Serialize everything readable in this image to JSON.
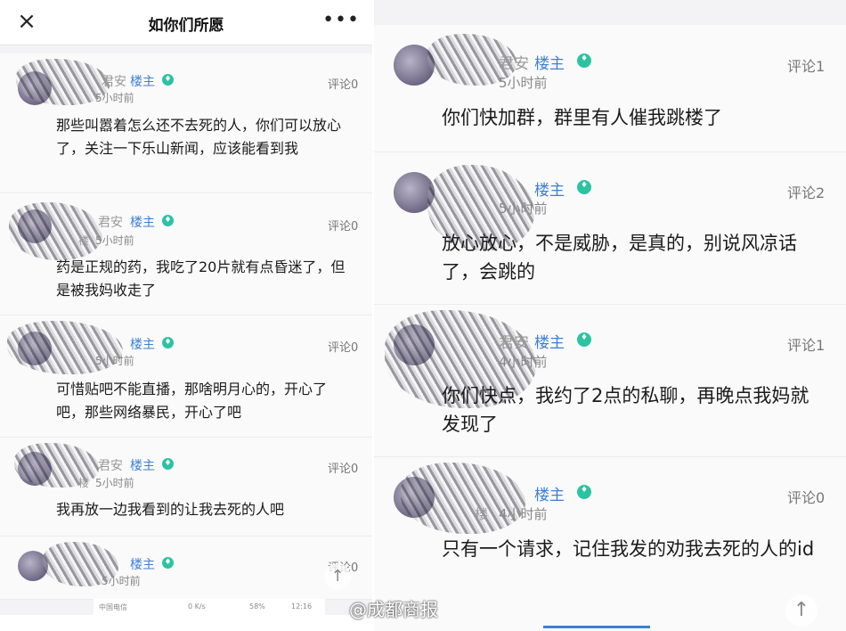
{
  "topbar": {
    "close_icon": "×",
    "title": "如你们所愿",
    "more_icon": "•••"
  },
  "louzhu_label": "楼主",
  "left_posts": [
    {
      "name": "君安",
      "time": "5小时前",
      "comment": "评论0",
      "body": "那些叫嚣着怎么还不去死的人，你们可以放心了，关注一下乐山新闻，应该能看到我"
    },
    {
      "name": "君安",
      "floor": "楼",
      "time": "5小时前",
      "comment": "评论0",
      "body": "药是正规的药，我吃了20片就有点昏迷了，但是被我妈收走了"
    },
    {
      "name": "",
      "time": "5小时前",
      "comment": "评论0",
      "body": "可惜贴吧不能直播，那啥明月心的，开心了吧，那些网络暴民，开心了吧"
    },
    {
      "name": "君安",
      "floor": "楼",
      "time": "5小时前",
      "comment": "评论0",
      "body": "我再放一边我看到的让我去死的人吧"
    },
    {
      "name": "",
      "time": "5小时前",
      "comment": "评论0",
      "body": ""
    }
  ],
  "right_posts": [
    {
      "name": "君安",
      "time": "5小时前",
      "comment": "评论1",
      "body": "你们快加群，群里有人催我跳楼了"
    },
    {
      "name": "",
      "time": "5小时前",
      "comment": "评论2",
      "body": "放心放心，不是威胁，是真的，别说风凉话了，会跳的"
    },
    {
      "name": "君安",
      "time": "4小时前",
      "comment": "评论1",
      "body": "你们快点，我约了2点的私聊，再晚点我妈就发现了"
    },
    {
      "name": "",
      "floor": "楼",
      "time": "4小时前",
      "comment": "评论0",
      "body": "只有一个请求，记住我发的劝我去死的人的id"
    }
  ],
  "statusbar": {
    "carrier": "中国电信",
    "speed": "0 K/s",
    "battery": "58%",
    "clock": "12:16"
  },
  "uparrow_icon": "↑",
  "watermark": "@成都商报"
}
